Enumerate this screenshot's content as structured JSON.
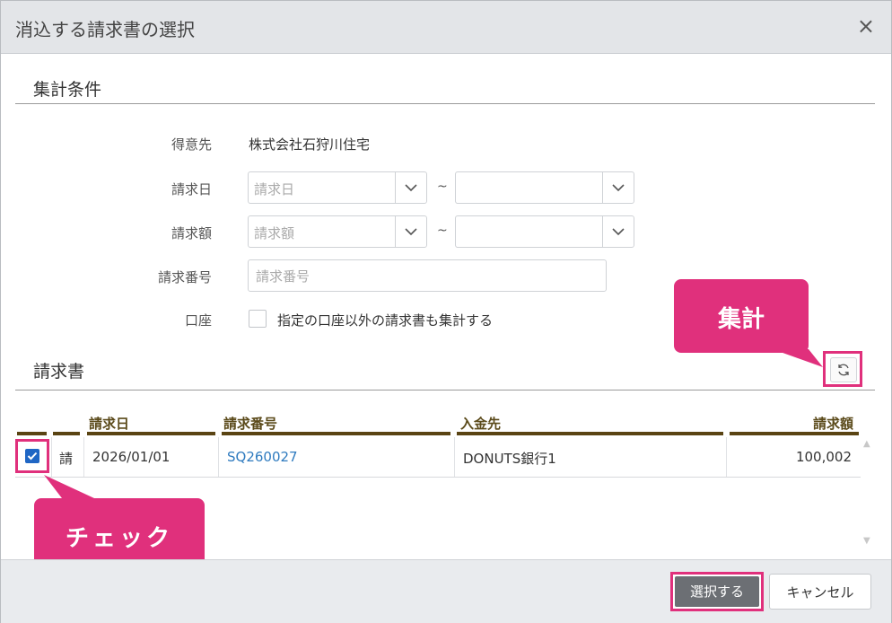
{
  "dialog": {
    "title": "消込する請求書の選択",
    "close_glyph": "×"
  },
  "criteria": {
    "heading": "集計条件",
    "customer_label": "得意先",
    "customer_value": "株式会社石狩川住宅",
    "date_label": "請求日",
    "date_from_placeholder": "請求日",
    "date_to_placeholder": "",
    "amount_label": "請求額",
    "amount_from_placeholder": "請求額",
    "amount_to_placeholder": "",
    "range_sep": "~",
    "number_label": "請求番号",
    "number_placeholder": "請求番号",
    "account_label": "口座",
    "account_checkbox_label": "指定の口座以外の請求書も集計する"
  },
  "invoices": {
    "heading": "請求書",
    "columns": [
      "請求日",
      "請求番号",
      "入金先",
      "請求額"
    ],
    "rows": [
      {
        "checked": true,
        "kind": "請",
        "date": "2026/01/01",
        "number": "SQ260027",
        "payee": "DONUTS銀行1",
        "amount": "100,002"
      }
    ]
  },
  "annotations": {
    "aggregate_callout": "集計",
    "check_callout": "チェック"
  },
  "footer": {
    "select_label": "選択する",
    "cancel_label": "キャンセル"
  },
  "icons": [
    "close-icon",
    "chevron-down-icon",
    "refresh-icon",
    "checkbox-checked-icon"
  ],
  "colors": {
    "callout": "#e0307c",
    "header_bar": "#5a4413",
    "link": "#2f7bbf",
    "checkbox": "#1f66c4",
    "primary_button": "#6c6f74"
  }
}
